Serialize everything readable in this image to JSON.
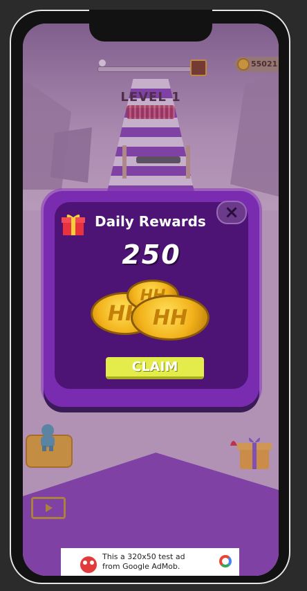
{
  "hud": {
    "coins": "55021",
    "level_label": "LEVEL 1",
    "progress_fraction": 0.0
  },
  "daily_rewards": {
    "title": "Daily Rewards",
    "amount": "250",
    "claim_label": "CLAIM",
    "close_icon": "close-icon"
  },
  "icons": {
    "gift": "gift-icon",
    "character": "character-icon",
    "video": "video-play-icon",
    "gift_bell": "gift-bell-icon",
    "coin": "coin-icon"
  },
  "ad": {
    "text": "This a 320x50 test ad from Google AdMob."
  },
  "colors": {
    "panel": "#7a2cb0",
    "panel_inner": "#4d1375",
    "claim_button": "#e4ec4b",
    "coin": "#f2b21b"
  }
}
